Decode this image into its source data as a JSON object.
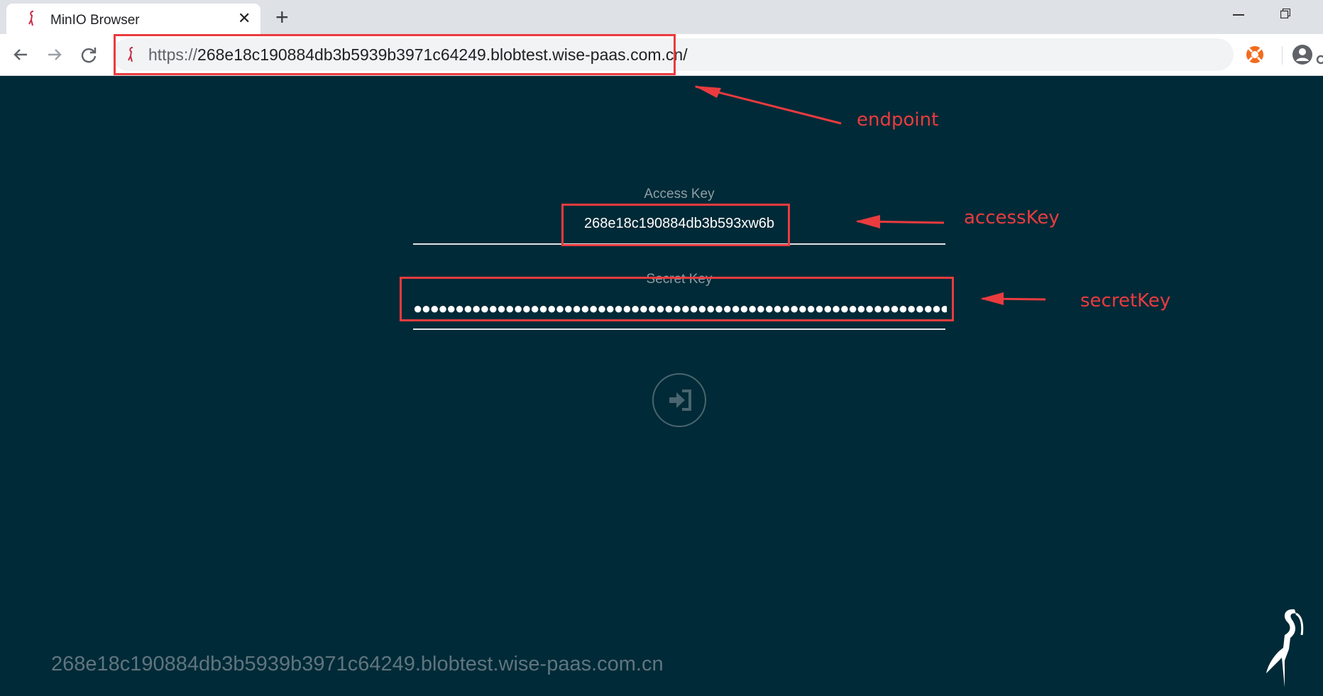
{
  "browser": {
    "tab_title": "MinIO Browser",
    "close_symbol": "✕",
    "new_tab_symbol": "+",
    "url_protocol": "https://",
    "url_rest": "268e18c190884db3b5939b3971c64249.blobtest.wise-paas.com.cn/"
  },
  "login": {
    "access_key_label": "Access Key",
    "access_key_value": "268e18c190884db3b593xw6b",
    "secret_key_label": "Secret Key",
    "secret_key_masked": "●●●●●●●●●●●●●●●●●●●●●●●●●●●●●●●●●●●●●●●●●●●●●●●●●●●●●●●●●●●●●●●●●●●●●●●●●●●"
  },
  "footer": {
    "host": "268e18c190884db3b5939b3971c64249.blobtest.wise-paas.com.cn"
  },
  "annotations": {
    "endpoint": "endpoint",
    "access_key": "accessKey",
    "secret_key": "secretKey",
    "color": "#ea3b3f"
  },
  "icons": {
    "tab": "minio-flamingo-icon",
    "back": "arrow-left-icon",
    "forward": "arrow-right-icon",
    "reload": "reload-icon",
    "key": "key-icon",
    "extension": "lifebuoy-icon",
    "profile": "account-icon",
    "login": "sign-in-icon"
  },
  "colors": {
    "page_background": "#002a37",
    "tabstrip": "#dee1e6"
  }
}
